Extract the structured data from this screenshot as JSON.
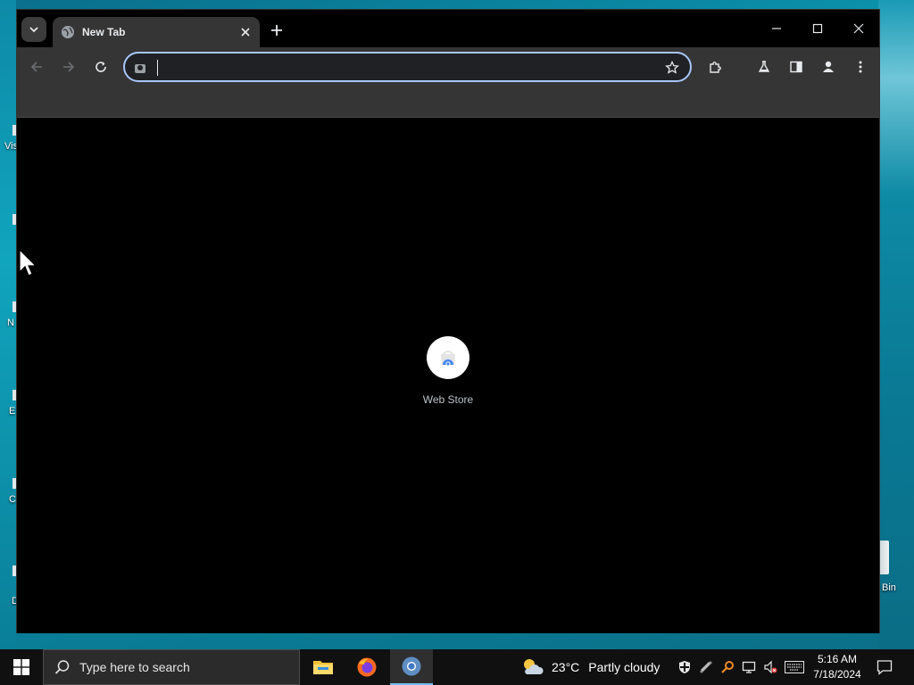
{
  "desktop": {
    "labels": [
      "Vis",
      "N",
      "E",
      "C",
      "D"
    ],
    "recycle_bin_label": "Bin"
  },
  "browser": {
    "tab": {
      "title": "New Tab"
    },
    "omnibox": {
      "value": "",
      "placeholder": ""
    },
    "shortcut": {
      "label": "Web Store"
    },
    "accent_color": "#a8c7fa"
  },
  "taskbar": {
    "search_placeholder": "Type here to search",
    "weather": {
      "temperature": "23°C",
      "condition": "Partly cloudy"
    },
    "clock": {
      "time": "5:16 AM",
      "date": "7/18/2024"
    }
  }
}
